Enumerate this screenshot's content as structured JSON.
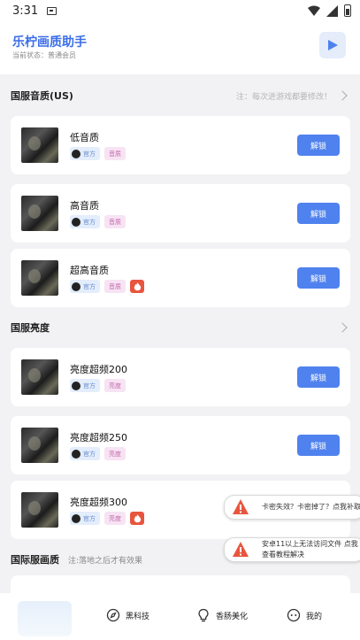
{
  "status_bar": {
    "time": "3:31"
  },
  "header": {
    "title": "乐柠画质助手",
    "subtitle": "当前状态：普通会员"
  },
  "sections": {
    "quality": {
      "name": "国服音质(US)",
      "note": "注：每次进游戏都要修改！"
    },
    "brightness": {
      "name": "国服亮度"
    },
    "intl": {
      "name": "国际服画质",
      "note": "注:落地之后才有效果"
    }
  },
  "items": [
    {
      "name": "低音质",
      "tag_official": "官方",
      "tag_kind": "音质",
      "button": "解锁"
    },
    {
      "name": "高音质",
      "tag_official": "官方",
      "tag_kind": "音质",
      "button": "解锁"
    },
    {
      "name": "超高音质",
      "tag_official": "官方",
      "tag_kind": "音质",
      "button": "解锁",
      "hot": true
    },
    {
      "name": "亮度超频200",
      "tag_official": "官方",
      "tag_kind": "亮度",
      "button": "解锁"
    },
    {
      "name": "亮度超频250",
      "tag_official": "官方",
      "tag_kind": "亮度",
      "button": "解锁"
    },
    {
      "name": "亮度超频300",
      "tag_official": "官方",
      "tag_kind": "亮度",
      "hot": true
    }
  ],
  "toasts": [
    {
      "text": "卡密失效？卡密掉了？点我补取"
    },
    {
      "text": "安卓11以上无法访问文件 点我查看教程解决"
    }
  ],
  "bottom_nav": [
    {
      "label": "黑科技",
      "icon": "compass-icon"
    },
    {
      "label": "香肠美化",
      "icon": "bulb-icon"
    },
    {
      "label": "我的",
      "icon": "profile-icon"
    }
  ],
  "colors": {
    "accent": "#4f82ee",
    "title": "#3c6ee8",
    "hot": "#e8553e"
  }
}
